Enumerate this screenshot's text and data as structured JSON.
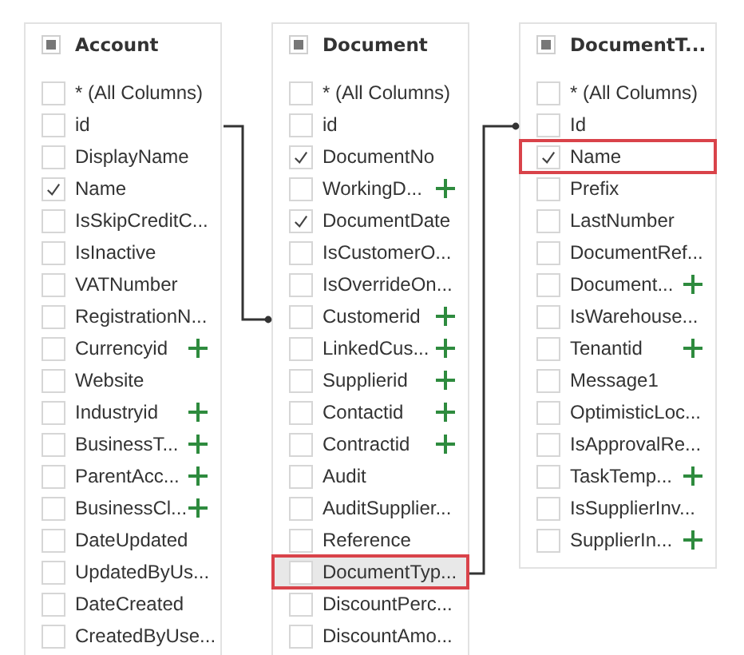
{
  "tables": [
    {
      "title": "Account",
      "partially_checked": true,
      "rows": [
        {
          "label": "* (All Columns)",
          "checked": false,
          "expandable": false,
          "highlighted": false,
          "hovered": false
        },
        {
          "label": "id",
          "checked": false,
          "expandable": false,
          "highlighted": false,
          "hovered": false
        },
        {
          "label": "DisplayName",
          "checked": false,
          "expandable": false,
          "highlighted": false,
          "hovered": false
        },
        {
          "label": "Name",
          "checked": true,
          "expandable": false,
          "highlighted": false,
          "hovered": false
        },
        {
          "label": "IsSkipCreditC...",
          "checked": false,
          "expandable": false,
          "highlighted": false,
          "hovered": false
        },
        {
          "label": "IsInactive",
          "checked": false,
          "expandable": false,
          "highlighted": false,
          "hovered": false
        },
        {
          "label": "VATNumber",
          "checked": false,
          "expandable": false,
          "highlighted": false,
          "hovered": false
        },
        {
          "label": "RegistrationN...",
          "checked": false,
          "expandable": false,
          "highlighted": false,
          "hovered": false
        },
        {
          "label": "Currencyid",
          "checked": false,
          "expandable": true,
          "highlighted": false,
          "hovered": false
        },
        {
          "label": "Website",
          "checked": false,
          "expandable": false,
          "highlighted": false,
          "hovered": false
        },
        {
          "label": "Industryid",
          "checked": false,
          "expandable": true,
          "highlighted": false,
          "hovered": false
        },
        {
          "label": "BusinessT...",
          "checked": false,
          "expandable": true,
          "highlighted": false,
          "hovered": false
        },
        {
          "label": "ParentAcc...",
          "checked": false,
          "expandable": true,
          "highlighted": false,
          "hovered": false
        },
        {
          "label": "BusinessCl...",
          "checked": false,
          "expandable": true,
          "highlighted": false,
          "hovered": false
        },
        {
          "label": "DateUpdated",
          "checked": false,
          "expandable": false,
          "highlighted": false,
          "hovered": false
        },
        {
          "label": "UpdatedByUs...",
          "checked": false,
          "expandable": false,
          "highlighted": false,
          "hovered": false
        },
        {
          "label": "DateCreated",
          "checked": false,
          "expandable": false,
          "highlighted": false,
          "hovered": false
        },
        {
          "label": "CreatedByUse...",
          "checked": false,
          "expandable": false,
          "highlighted": false,
          "hovered": false
        }
      ]
    },
    {
      "title": "Document",
      "partially_checked": true,
      "rows": [
        {
          "label": "* (All Columns)",
          "checked": false,
          "expandable": false,
          "highlighted": false,
          "hovered": false
        },
        {
          "label": "id",
          "checked": false,
          "expandable": false,
          "highlighted": false,
          "hovered": false
        },
        {
          "label": "DocumentNo",
          "checked": true,
          "expandable": false,
          "highlighted": false,
          "hovered": false
        },
        {
          "label": "WorkingD...",
          "checked": false,
          "expandable": true,
          "highlighted": false,
          "hovered": false
        },
        {
          "label": "DocumentDate",
          "checked": true,
          "expandable": false,
          "highlighted": false,
          "hovered": false
        },
        {
          "label": "IsCustomerO...",
          "checked": false,
          "expandable": false,
          "highlighted": false,
          "hovered": false
        },
        {
          "label": "IsOverrideOn...",
          "checked": false,
          "expandable": false,
          "highlighted": false,
          "hovered": false
        },
        {
          "label": "Customerid",
          "checked": false,
          "expandable": true,
          "highlighted": false,
          "hovered": false
        },
        {
          "label": "LinkedCus...",
          "checked": false,
          "expandable": true,
          "highlighted": false,
          "hovered": false
        },
        {
          "label": "Supplierid",
          "checked": false,
          "expandable": true,
          "highlighted": false,
          "hovered": false
        },
        {
          "label": "Contactid",
          "checked": false,
          "expandable": true,
          "highlighted": false,
          "hovered": false
        },
        {
          "label": "Contractid",
          "checked": false,
          "expandable": true,
          "highlighted": false,
          "hovered": false
        },
        {
          "label": "Audit",
          "checked": false,
          "expandable": false,
          "highlighted": false,
          "hovered": false
        },
        {
          "label": "AuditSupplier...",
          "checked": false,
          "expandable": false,
          "highlighted": false,
          "hovered": false
        },
        {
          "label": "Reference",
          "checked": false,
          "expandable": false,
          "highlighted": false,
          "hovered": false
        },
        {
          "label": "DocumentTyp...",
          "checked": false,
          "expandable": false,
          "highlighted": true,
          "hovered": true
        },
        {
          "label": "DiscountPerc...",
          "checked": false,
          "expandable": false,
          "highlighted": false,
          "hovered": false
        },
        {
          "label": "DiscountAmo...",
          "checked": false,
          "expandable": false,
          "highlighted": false,
          "hovered": false
        }
      ]
    },
    {
      "title": "DocumentT...",
      "partially_checked": true,
      "rows": [
        {
          "label": "* (All Columns)",
          "checked": false,
          "expandable": false,
          "highlighted": false,
          "hovered": false
        },
        {
          "label": "Id",
          "checked": false,
          "expandable": false,
          "highlighted": false,
          "hovered": false
        },
        {
          "label": "Name",
          "checked": true,
          "expandable": false,
          "highlighted": true,
          "hovered": false
        },
        {
          "label": "Prefix",
          "checked": false,
          "expandable": false,
          "highlighted": false,
          "hovered": false
        },
        {
          "label": "LastNumber",
          "checked": false,
          "expandable": false,
          "highlighted": false,
          "hovered": false
        },
        {
          "label": "DocumentRef...",
          "checked": false,
          "expandable": false,
          "highlighted": false,
          "hovered": false
        },
        {
          "label": "Document...",
          "checked": false,
          "expandable": true,
          "highlighted": false,
          "hovered": false
        },
        {
          "label": "IsWarehouse...",
          "checked": false,
          "expandable": false,
          "highlighted": false,
          "hovered": false
        },
        {
          "label": "Tenantid",
          "checked": false,
          "expandable": true,
          "highlighted": false,
          "hovered": false
        },
        {
          "label": "Message1",
          "checked": false,
          "expandable": false,
          "highlighted": false,
          "hovered": false
        },
        {
          "label": "OptimisticLoc...",
          "checked": false,
          "expandable": false,
          "highlighted": false,
          "hovered": false
        },
        {
          "label": "IsApprovalRe...",
          "checked": false,
          "expandable": false,
          "highlighted": false,
          "hovered": false
        },
        {
          "label": "TaskTemp...",
          "checked": false,
          "expandable": true,
          "highlighted": false,
          "hovered": false
        },
        {
          "label": "IsSupplierInv...",
          "checked": false,
          "expandable": false,
          "highlighted": false,
          "hovered": false
        },
        {
          "label": "SupplierIn...",
          "checked": false,
          "expandable": true,
          "highlighted": false,
          "hovered": false
        }
      ]
    }
  ]
}
